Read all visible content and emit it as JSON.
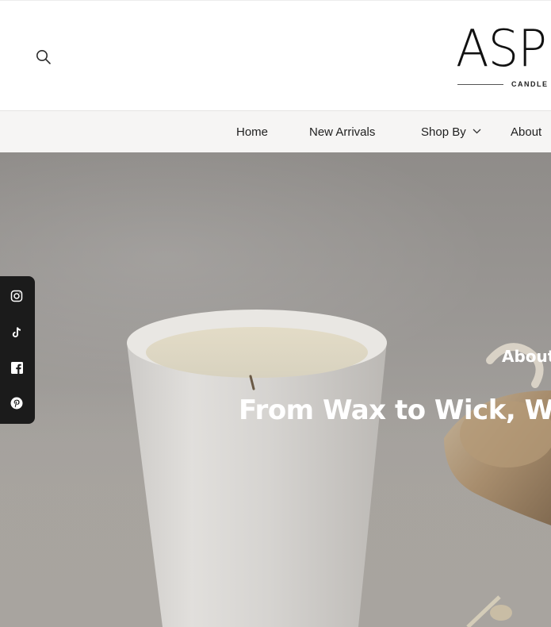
{
  "header": {
    "search_icon": "search-icon",
    "logo": {
      "main": "ASP",
      "sub": "CANDLE"
    }
  },
  "nav": {
    "items": [
      {
        "label": "Home"
      },
      {
        "label": "New Arrivals"
      },
      {
        "label": "Shop By",
        "icon": "chevron-down-icon"
      },
      {
        "label": "About"
      }
    ]
  },
  "hero": {
    "kicker": "About",
    "heading": "From Wax to Wick, We C"
  },
  "social": {
    "icons": [
      "instagram-icon",
      "tiktok-icon",
      "facebook-icon",
      "pinterest-icon"
    ]
  },
  "colors": {
    "nav_bg": "#f6f5f4",
    "social_bar": "#1b1b1b",
    "hero_text": "#ffffff"
  }
}
